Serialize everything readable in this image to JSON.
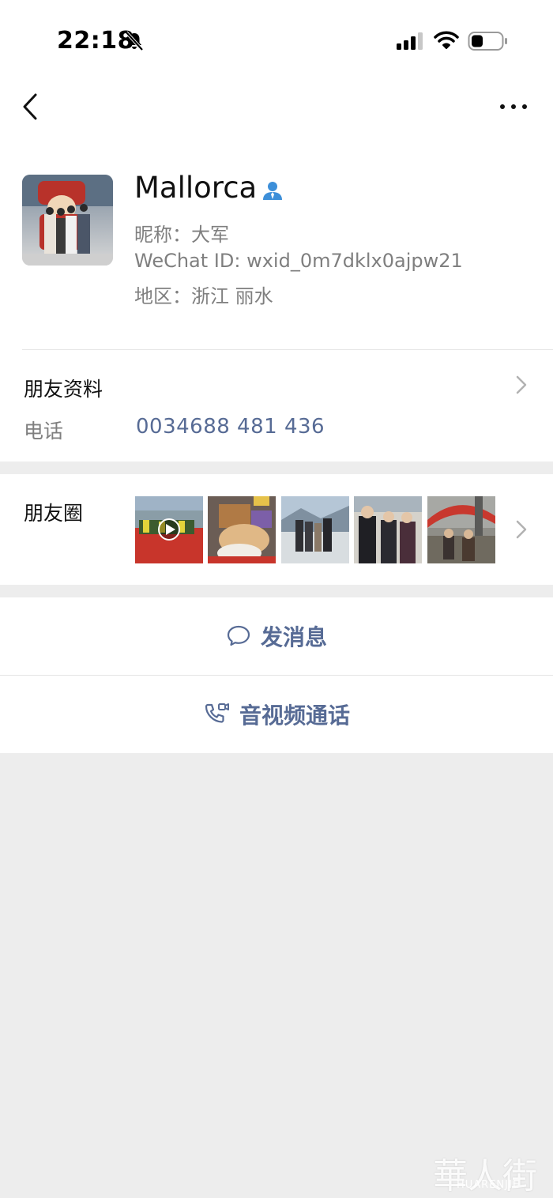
{
  "status_bar": {
    "time": "22:18"
  },
  "profile": {
    "name": "Mallorca",
    "nickname": "昵称：大军",
    "wechat_id": "WeChat ID: wxid_0m7dklx0ajpw21",
    "region": "地区：浙江 丽水"
  },
  "friend_info": {
    "label": "朋友资料",
    "phone_label": "电话",
    "phone_value": "0034688 481 436"
  },
  "moments": {
    "label": "朋友圈"
  },
  "actions": {
    "message": "发消息",
    "call": "音视频通话"
  },
  "watermark": {
    "logo": "華人街",
    "text": "HUARENJIE"
  },
  "colors": {
    "link": "#576b95",
    "background": "#ededed",
    "verified_icon": "#3d8fd9"
  }
}
